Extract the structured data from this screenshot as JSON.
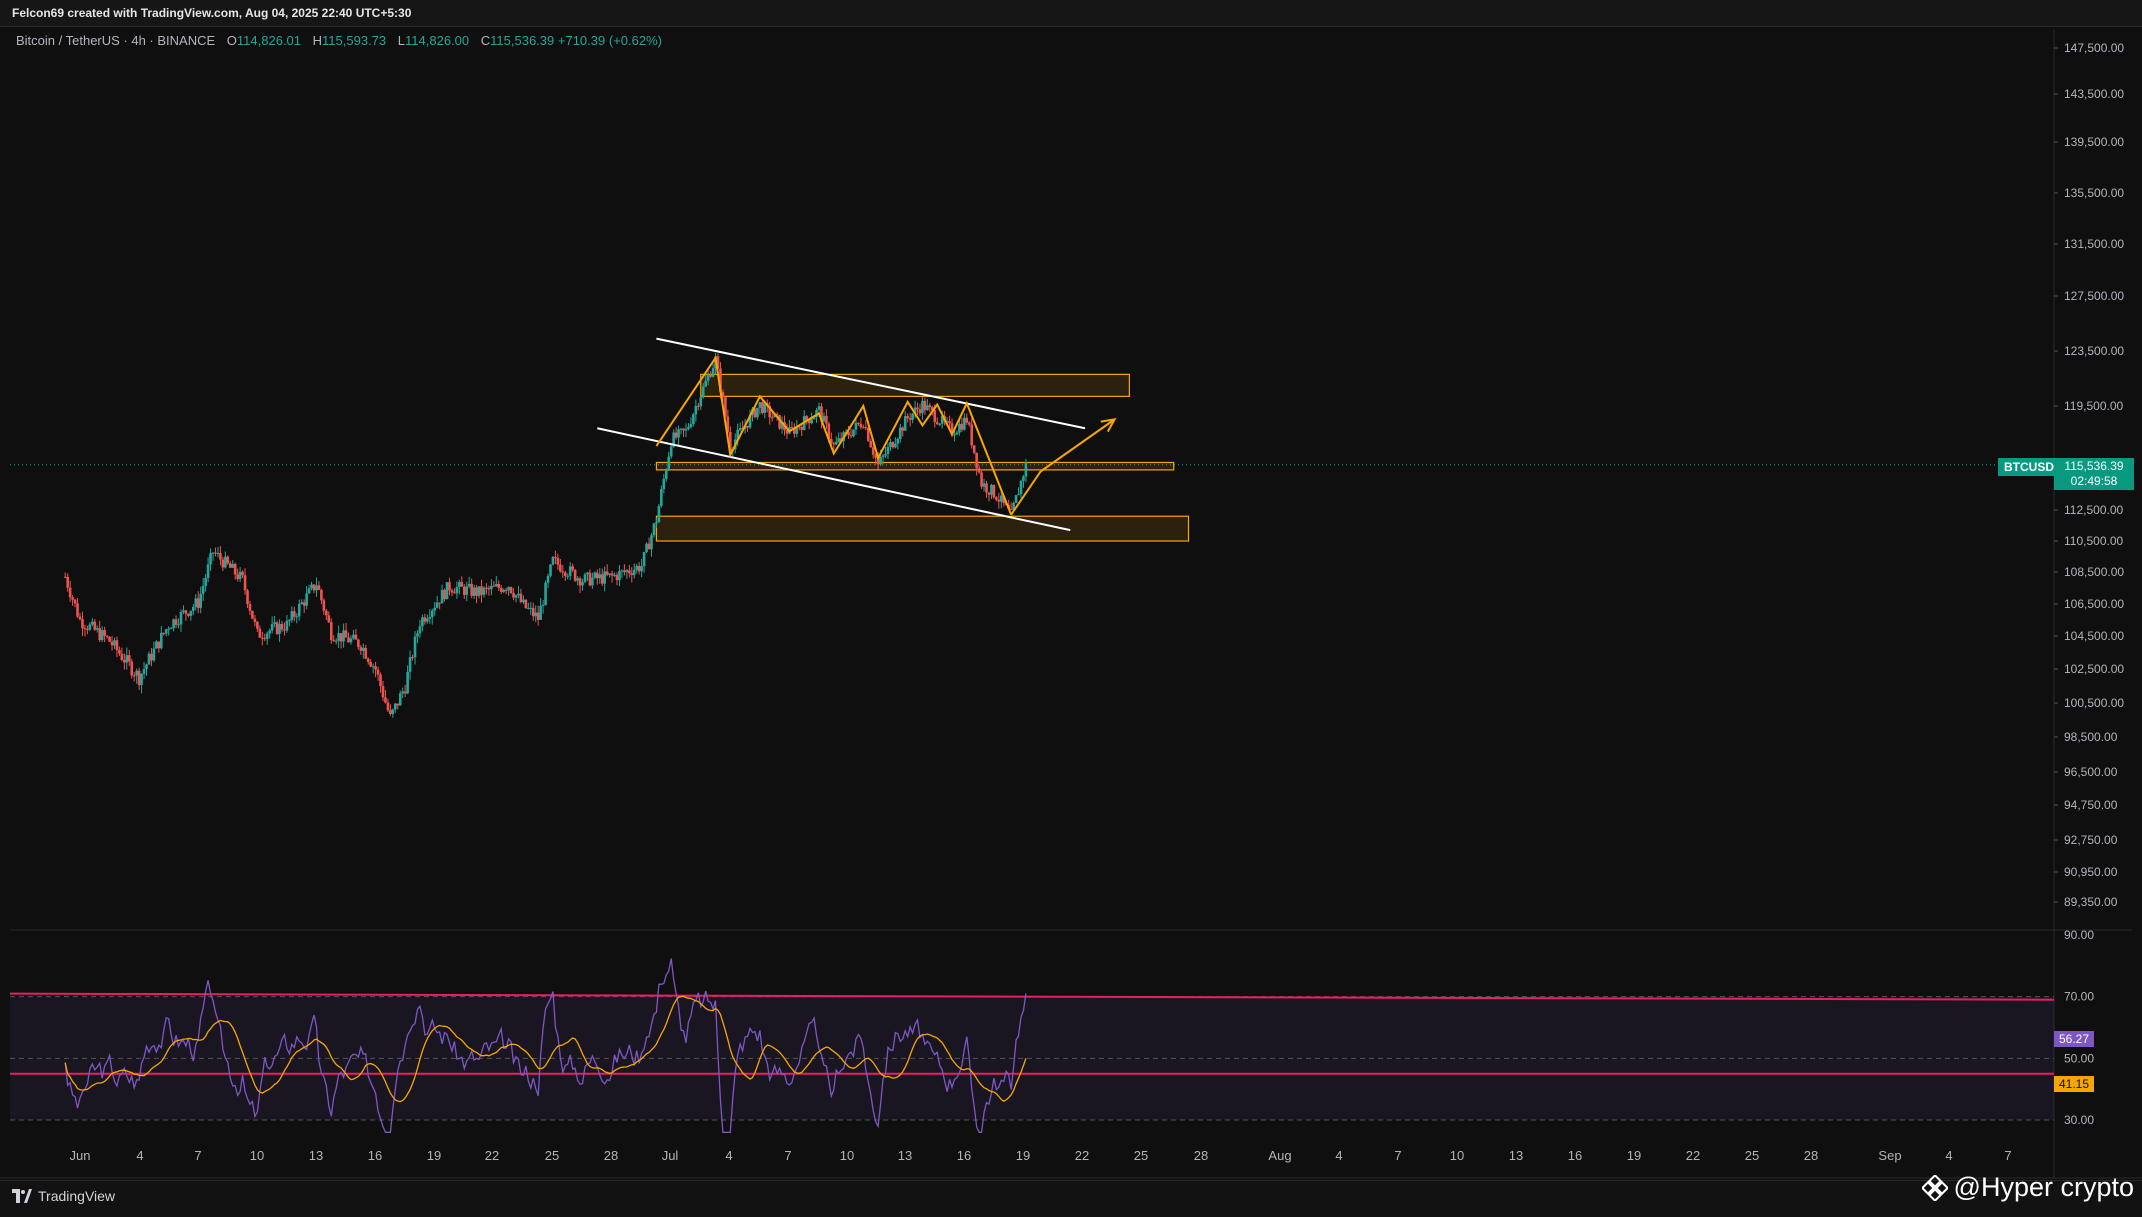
{
  "header": {
    "title": "Felcon69 created with TradingView.com, Aug 04, 2025 22:40 UTC+5:30"
  },
  "legend": {
    "symbol": "Bitcoin / TetherUS · 4h · BINANCE",
    "o_label": "O",
    "o_value": "114,826.01",
    "h_label": "H",
    "h_value": "115,593.73",
    "l_label": "L",
    "l_value": "114,826.00",
    "c_label": "C",
    "c_value": "115,536.39",
    "change": "+710.39 (+0.62%)"
  },
  "price_tags": {
    "symbol_tag": "BTCUSDT",
    "last_price": "115,536.39",
    "countdown": "02:49:58",
    "rsi_value": "56.27",
    "rsi_ma_value": "41.15"
  },
  "footer": {
    "brand": "TradingView",
    "watermark": "@Hyper crypto"
  },
  "colors": {
    "up": "#26a69a",
    "down": "#ef5350",
    "rsi": "#7e57c2",
    "rsi_ma": "#f7a600",
    "band": "#e91e63",
    "zone": "#f7a600",
    "trend": "#ffffff"
  },
  "chart_data": {
    "type": "candlestick",
    "symbol": "Bitcoin / TetherUS",
    "interval": "4h",
    "exchange": "BINANCE",
    "y_axis_ticks": [
      "147,500.00",
      "143,500.00",
      "139,500.00",
      "135,500.00",
      "131,500.00",
      "127,500.00",
      "123,500.00",
      "119,500.00",
      "115,536.39",
      "112,500.00",
      "110,500.00",
      "108,500.00",
      "106,500.00",
      "104,500.00",
      "102,500.00",
      "100,500.00",
      "98,500.00",
      "96,500.00",
      "94,750.00",
      "92,750.00",
      "90,950.00",
      "89,350.00"
    ],
    "x_axis_ticks": [
      "Jun",
      "4",
      "7",
      "10",
      "13",
      "16",
      "19",
      "22",
      "25",
      "28",
      "Jul",
      "4",
      "7",
      "10",
      "13",
      "16",
      "19",
      "22",
      "25",
      "28",
      "Aug",
      "4",
      "7",
      "10",
      "13",
      "16",
      "19",
      "22",
      "25",
      "28",
      "Sep",
      "4",
      "7"
    ],
    "price_path": [
      [
        "2025-05-31",
        108200
      ],
      [
        "2025-06-01",
        105500
      ],
      [
        "2025-06-03",
        104200
      ],
      [
        "2025-06-05",
        102000
      ],
      [
        "2025-06-07",
        105200
      ],
      [
        "2025-06-09",
        106600
      ],
      [
        "2025-06-10",
        109800
      ],
      [
        "2025-06-12",
        108000
      ],
      [
        "2025-06-13",
        104600
      ],
      [
        "2025-06-15",
        105200
      ],
      [
        "2025-06-17",
        107800
      ],
      [
        "2025-06-18",
        104700
      ],
      [
        "2025-06-20",
        104000
      ],
      [
        "2025-06-21",
        102500
      ],
      [
        "2025-06-22",
        99600
      ],
      [
        "2025-06-23",
        101500
      ],
      [
        "2025-06-24",
        105400
      ],
      [
        "2025-06-26",
        107600
      ],
      [
        "2025-06-28",
        107200
      ],
      [
        "2025-06-30",
        107700
      ],
      [
        "2025-07-01",
        106400
      ],
      [
        "2025-07-02",
        105600
      ],
      [
        "2025-07-03",
        109200
      ],
      [
        "2025-07-05",
        108000
      ],
      [
        "2025-07-07",
        108200
      ],
      [
        "2025-07-09",
        108900
      ],
      [
        "2025-07-10",
        111900
      ],
      [
        "2025-07-11",
        117200
      ],
      [
        "2025-07-12",
        117800
      ],
      [
        "2025-07-14",
        122900
      ],
      [
        "2025-07-15",
        116800
      ],
      [
        "2025-07-17",
        119600
      ],
      [
        "2025-07-19",
        117700
      ],
      [
        "2025-07-21",
        119200
      ],
      [
        "2025-07-22",
        116800
      ],
      [
        "2025-07-24",
        118500
      ],
      [
        "2025-07-25",
        115500
      ],
      [
        "2025-07-27",
        118700
      ],
      [
        "2025-07-28",
        119600
      ],
      [
        "2025-07-30",
        117800
      ],
      [
        "2025-07-31",
        118600
      ],
      [
        "2025-08-01",
        114300
      ],
      [
        "2025-08-02",
        113500
      ],
      [
        "2025-08-03",
        112100
      ],
      [
        "2025-08-04",
        115536
      ]
    ],
    "zones": [
      {
        "name": "",
        "from_date": "2025-07-13",
        "to_date": "2025-08-11",
        "low": 120200,
        "high": 121800
      },
      {
        "name": "",
        "from_date": "2025-07-10",
        "to_date": "2025-08-14",
        "low": 115200,
        "high": 115700
      },
      {
        "name": "",
        "from_date": "2025-07-10",
        "to_date": "2025-08-15",
        "low": 110500,
        "high": 112100
      }
    ],
    "trendlines": [
      {
        "from": [
          "2025-07-10",
          124400
        ],
        "to": [
          "2025-08-08",
          118000
        ]
      },
      {
        "from": [
          "2025-07-06",
          118000
        ],
        "to": [
          "2025-08-07",
          111200
        ]
      }
    ],
    "projection_arrow": {
      "from": [
        "2025-08-05",
        115100
      ],
      "to": [
        "2025-08-10",
        118600
      ]
    },
    "rsi": {
      "levels": [
        90,
        70,
        50,
        30
      ],
      "last_value": 56.27,
      "ma_last_value": 41.15,
      "upper_band": 70,
      "lower_band": 45
    }
  }
}
